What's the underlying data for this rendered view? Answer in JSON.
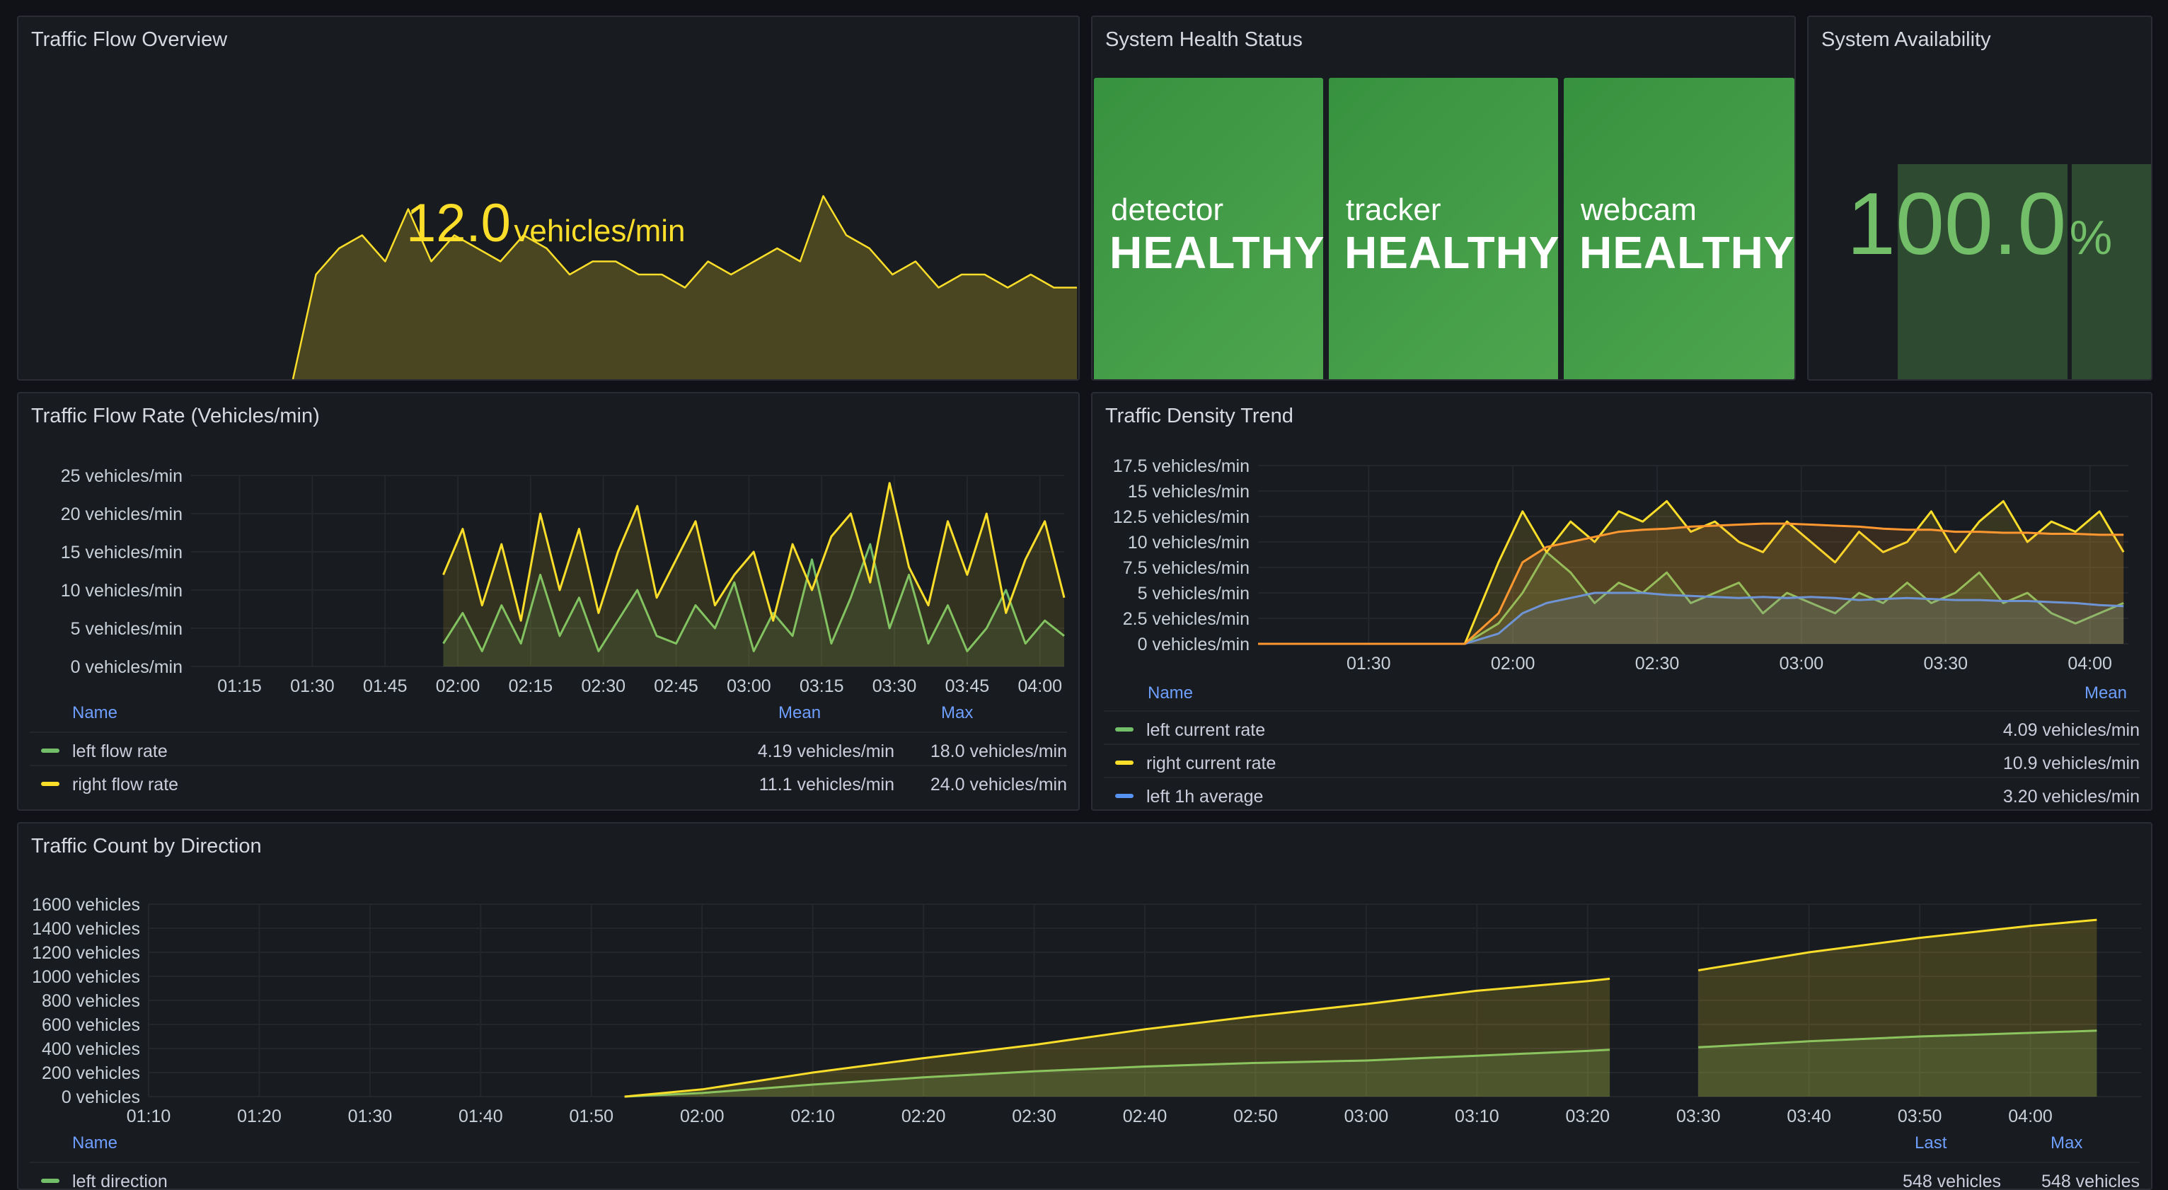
{
  "panels": {
    "flow_overview": {
      "title": "Traffic Flow Overview",
      "value": "12.0",
      "unit": "vehicles/min",
      "color": "#fade2a"
    },
    "health": {
      "title": "System Health Status",
      "tiles": [
        {
          "name": "detector",
          "status": "HEALTHY"
        },
        {
          "name": "tracker",
          "status": "HEALTHY"
        },
        {
          "name": "webcam",
          "status": "HEALTHY"
        }
      ]
    },
    "availability": {
      "title": "System Availability",
      "value": "100.0",
      "unit": "%"
    },
    "flow_rate": {
      "title": "Traffic Flow Rate (Vehicles/min)",
      "legend_headers": {
        "name": "Name",
        "mean": "Mean",
        "max": "Max"
      },
      "legend": [
        {
          "name": "left flow rate",
          "mean": "4.19 vehicles/min",
          "max": "18.0 vehicles/min",
          "color": "#73bf69"
        },
        {
          "name": "right flow rate",
          "mean": "11.1 vehicles/min",
          "max": "24.0 vehicles/min",
          "color": "#fade2a"
        }
      ]
    },
    "density": {
      "title": "Traffic Density Trend",
      "legend_headers": {
        "name": "Name",
        "mean": "Mean"
      },
      "legend": [
        {
          "name": "left current rate",
          "mean": "4.09 vehicles/min",
          "color": "#73bf69"
        },
        {
          "name": "right current rate",
          "mean": "10.9 vehicles/min",
          "color": "#fade2a"
        },
        {
          "name": "left 1h average",
          "mean": "3.20 vehicles/min",
          "color": "#5794f2"
        }
      ]
    },
    "count": {
      "title": "Traffic Count by Direction",
      "legend_headers": {
        "name": "Name",
        "last": "Last",
        "max": "Max"
      },
      "legend": [
        {
          "name": "left direction",
          "last": "548 vehicles",
          "max": "548 vehicles",
          "color": "#73bf69"
        }
      ]
    }
  },
  "chart_data": [
    {
      "type": "area",
      "title": "Traffic Flow Overview",
      "x": [
        "01:53",
        "01:57",
        "02:00",
        "02:04",
        "02:08",
        "02:12",
        "02:16",
        "02:20",
        "02:24",
        "02:28",
        "02:32",
        "02:36",
        "02:40",
        "02:44",
        "02:48",
        "02:52",
        "02:56",
        "03:00",
        "03:04",
        "03:08",
        "03:12",
        "03:16",
        "03:20",
        "03:24",
        "03:28",
        "03:32",
        "03:36",
        "03:40",
        "03:44",
        "03:48",
        "03:52",
        "03:56",
        "04:00",
        "04:04",
        "04:08"
      ],
      "series": [
        {
          "values": [
            0,
            8,
            10,
            11,
            9,
            13,
            9,
            11,
            10,
            9,
            11,
            10,
            8,
            9,
            9,
            8,
            8,
            7,
            9,
            8,
            9,
            10,
            9,
            14,
            11,
            10,
            8,
            9,
            7,
            8,
            8,
            7,
            8,
            7,
            7
          ],
          "color": "#fade2a"
        }
      ]
    },
    {
      "type": "bar",
      "title": "System Availability",
      "categories": [
        "",
        ""
      ],
      "values": [
        100,
        100
      ],
      "ylim": [
        0,
        180
      ]
    },
    {
      "type": "line",
      "title": "Traffic Flow Rate (Vehicles/min)",
      "x_ticks": [
        "01:15",
        "01:30",
        "01:45",
        "02:00",
        "02:15",
        "02:30",
        "02:45",
        "03:00",
        "03:15",
        "03:30",
        "03:45",
        "04:00"
      ],
      "y_ticks": [
        "25 vehicles/min",
        "20 vehicles/min",
        "15 vehicles/min",
        "10 vehicles/min",
        "5 vehicles/min",
        "0 vehicles/min"
      ],
      "ylim": [
        0,
        25
      ],
      "x_start_min": 65,
      "x_end_min": 245,
      "x": [
        "01:57",
        "02:01",
        "02:05",
        "02:09",
        "02:13",
        "02:17",
        "02:21",
        "02:25",
        "02:29",
        "02:33",
        "02:37",
        "02:41",
        "02:45",
        "02:49",
        "02:53",
        "02:57",
        "03:01",
        "03:05",
        "03:09",
        "03:13",
        "03:17",
        "03:21",
        "03:25",
        "03:29",
        "03:33",
        "03:37",
        "03:41",
        "03:45",
        "03:49",
        "03:53",
        "03:57",
        "04:01",
        "04:05"
      ],
      "series": [
        {
          "name": "left flow rate",
          "color": "#73bf69",
          "values": [
            3,
            7,
            2,
            8,
            3,
            12,
            4,
            9,
            2,
            6,
            10,
            4,
            3,
            8,
            5,
            11,
            2,
            7,
            4,
            14,
            3,
            9,
            16,
            5,
            12,
            3,
            8,
            2,
            5,
            10,
            3,
            6,
            4
          ]
        },
        {
          "name": "right flow rate",
          "color": "#fade2a",
          "values": [
            12,
            18,
            8,
            16,
            6,
            20,
            10,
            18,
            7,
            15,
            21,
            9,
            14,
            19,
            8,
            12,
            15,
            6,
            16,
            10,
            17,
            20,
            11,
            24,
            13,
            8,
            19,
            12,
            20,
            7,
            14,
            19,
            9
          ]
        }
      ]
    },
    {
      "type": "line",
      "title": "Traffic Density Trend",
      "x_ticks": [
        "01:30",
        "02:00",
        "02:30",
        "03:00",
        "03:30",
        "04:00"
      ],
      "y_ticks": [
        "17.5 vehicles/min",
        "15 vehicles/min",
        "12.5 vehicles/min",
        "10 vehicles/min",
        "7.5 vehicles/min",
        "5 vehicles/min",
        "2.5 vehicles/min",
        "0 vehicles/min"
      ],
      "ylim": [
        0,
        17.5
      ],
      "x_start_min": 67,
      "x_end_min": 248,
      "x": [
        "01:07",
        "01:50",
        "01:57",
        "02:02",
        "02:07",
        "02:12",
        "02:17",
        "02:22",
        "02:27",
        "02:32",
        "02:37",
        "02:42",
        "02:47",
        "02:52",
        "02:57",
        "03:02",
        "03:07",
        "03:12",
        "03:17",
        "03:22",
        "03:27",
        "03:32",
        "03:37",
        "03:42",
        "03:47",
        "03:52",
        "03:57",
        "04:02",
        "04:07"
      ],
      "series": [
        {
          "name": "left current rate",
          "color": "#73bf69",
          "values": [
            0,
            0,
            2,
            5,
            9,
            7,
            4,
            6,
            5,
            7,
            4,
            5,
            6,
            3,
            5,
            4,
            3,
            5,
            4,
            6,
            4,
            5,
            7,
            4,
            5,
            3,
            2,
            3,
            4
          ]
        },
        {
          "name": "right current rate",
          "color": "#fade2a",
          "values": [
            0,
            0,
            8,
            13,
            9,
            12,
            10,
            13,
            12,
            14,
            11,
            12,
            10,
            9,
            12,
            10,
            8,
            11,
            9,
            10,
            13,
            9,
            12,
            14,
            10,
            12,
            11,
            13,
            9
          ]
        },
        {
          "name": "left 1h average",
          "color": "#5794f2",
          "values": [
            0,
            0,
            1,
            3,
            4,
            4.5,
            5,
            5,
            5,
            4.8,
            4.7,
            4.6,
            4.5,
            4.6,
            4.5,
            4.6,
            4.5,
            4.3,
            4.4,
            4.5,
            4.4,
            4.3,
            4.3,
            4.2,
            4.2,
            4.1,
            4.0,
            3.8,
            3.7
          ]
        },
        {
          "color": "#ff9830",
          "values": [
            0,
            0,
            3,
            8,
            9.5,
            10,
            10.5,
            11,
            11.2,
            11.3,
            11.5,
            11.6,
            11.7,
            11.8,
            11.8,
            11.7,
            11.6,
            11.5,
            11.3,
            11.2,
            11.2,
            11.0,
            11.0,
            10.9,
            10.9,
            10.8,
            10.8,
            10.7,
            10.7
          ]
        }
      ]
    },
    {
      "type": "area",
      "title": "Traffic Count by Direction",
      "x_ticks": [
        "01:10",
        "01:20",
        "01:30",
        "01:40",
        "01:50",
        "02:00",
        "02:10",
        "02:20",
        "02:30",
        "02:40",
        "02:50",
        "03:00",
        "03:10",
        "03:20",
        "03:30",
        "03:40",
        "03:50",
        "04:00"
      ],
      "y_ticks": [
        "1600 vehicles",
        "1400 vehicles",
        "1200 vehicles",
        "1000 vehicles",
        "800 vehicles",
        "600 vehicles",
        "400 vehicles",
        "200 vehicles",
        "0 vehicles"
      ],
      "ylim": [
        0,
        1600
      ],
      "x_start_min": 70,
      "x_end_min": 250,
      "x": [
        "01:53",
        "02:00",
        "02:10",
        "02:20",
        "02:30",
        "02:40",
        "02:50",
        "03:00",
        "03:10",
        "03:20",
        "03:22",
        "03:24",
        "03:30",
        "03:40",
        "03:50",
        "04:00",
        "04:06"
      ],
      "series": [
        {
          "name": "left direction",
          "color": "#73bf69",
          "values": [
            0,
            30,
            100,
            160,
            210,
            250,
            280,
            300,
            340,
            380,
            390,
            null,
            410,
            460,
            500,
            530,
            548
          ]
        },
        {
          "color": "#fade2a",
          "values": [
            0,
            60,
            200,
            320,
            430,
            560,
            670,
            770,
            880,
            960,
            980,
            null,
            1050,
            1200,
            1320,
            1420,
            1470
          ]
        }
      ]
    }
  ]
}
